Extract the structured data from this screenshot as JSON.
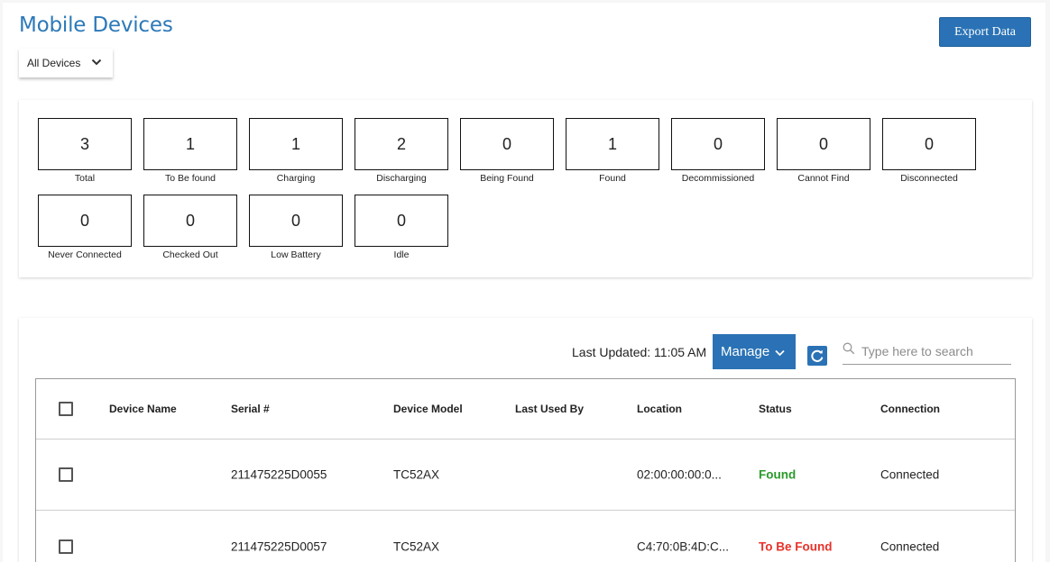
{
  "header": {
    "title": "Mobile Devices",
    "export_label": "Export Data",
    "filter_value": "All Devices"
  },
  "stats": [
    {
      "value": "3",
      "label": "Total"
    },
    {
      "value": "1",
      "label": "To Be found"
    },
    {
      "value": "1",
      "label": "Charging"
    },
    {
      "value": "2",
      "label": "Discharging"
    },
    {
      "value": "0",
      "label": "Being Found"
    },
    {
      "value": "1",
      "label": "Found"
    },
    {
      "value": "0",
      "label": "Decommissioned"
    },
    {
      "value": "0",
      "label": "Cannot Find"
    },
    {
      "value": "0",
      "label": "Disconnected"
    },
    {
      "value": "0",
      "label": "Never Connected"
    },
    {
      "value": "0",
      "label": "Checked Out"
    },
    {
      "value": "0",
      "label": "Low Battery"
    },
    {
      "value": "0",
      "label": "Idle"
    }
  ],
  "toolbar": {
    "last_updated": "Last Updated: 11:05 AM",
    "manage_label": "Manage",
    "search_placeholder": "Type here to search"
  },
  "table": {
    "columns": [
      "Device Name",
      "Serial #",
      "Device Model",
      "Last Used By",
      "Location",
      "Status",
      "Connection"
    ],
    "rows": [
      {
        "device_name": "",
        "serial": "211475225D0055",
        "model": "TC52AX",
        "last_used_by": "",
        "location": "02:00:00:00:0...",
        "status": "Found",
        "connection": "Connected"
      },
      {
        "device_name": "",
        "serial": "211475225D0057",
        "model": "TC52AX",
        "last_used_by": "",
        "location": "C4:70:0B:4D:C...",
        "status": "To Be Found",
        "connection": "Connected"
      }
    ]
  },
  "colors": {
    "accent": "#2a72b5",
    "title": "#2d79b8",
    "status_found": "#2a9a2a",
    "status_to_be_found": "#e8322a"
  },
  "icons": {
    "filter_chevron": "chevron-down-icon",
    "manage_chevron": "chevron-down-icon",
    "refresh": "refresh-icon",
    "search": "search-icon"
  }
}
